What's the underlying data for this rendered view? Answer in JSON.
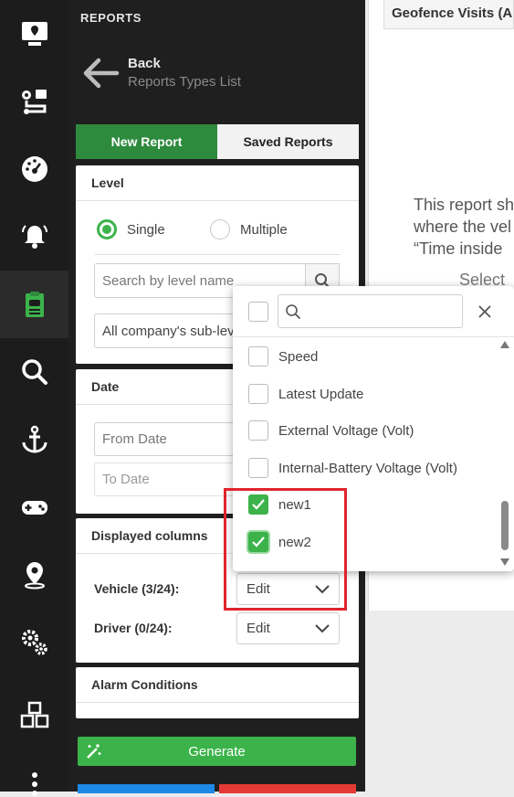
{
  "sidebar": {
    "icons": [
      "monitor-pin-icon",
      "route-icon",
      "dashboard-icon",
      "alarm-bell-icon",
      "reports-clipboard-icon",
      "search-icon",
      "anchor-icon",
      "gamepad-icon",
      "location-pin-icon",
      "gears-icon",
      "cubes-icon",
      "more-vertical-icon"
    ],
    "active_index": 4
  },
  "panel": {
    "title": "REPORTS",
    "back_label": "Back",
    "back_sub": "Reports Types List",
    "tabs": {
      "new": "New Report",
      "saved": "Saved Reports"
    },
    "level": {
      "title": "Level",
      "single": "Single",
      "multiple": "Multiple",
      "search_placeholder": "Search by level name",
      "sublevels_value": "All company's sub-levels"
    },
    "date": {
      "title": "Date",
      "from_placeholder": "From Date",
      "to_placeholder": "To Date"
    },
    "columns": {
      "title": "Displayed columns",
      "vehicle_label": "Vehicle (3/24):",
      "driver_label": "Driver (0/24):",
      "edit_label": "Edit"
    },
    "alarm_title": "Alarm Conditions",
    "generate_label": "Generate"
  },
  "main": {
    "tab_title": "Geofence Visits (Alarm",
    "desc_lines": [
      "This report sh",
      "where the vel",
      "“Time inside",
      "Select"
    ]
  },
  "dropdown": {
    "items": [
      {
        "label": "Speed",
        "checked": false
      },
      {
        "label": "Latest Update",
        "checked": false
      },
      {
        "label": "External Voltage (Volt)",
        "checked": false
      },
      {
        "label": "Internal-Battery Voltage (Volt)",
        "checked": false
      },
      {
        "label": "new1",
        "checked": true
      },
      {
        "label": "new2",
        "checked": true
      }
    ]
  },
  "colors": {
    "accent_green": "#3cb34a",
    "tab_green": "#2e8b3e",
    "highlight_red": "#e0242b",
    "rail_bg": "#1c1c1c",
    "blue_button": "#1e88e5",
    "red_button": "#e53935"
  }
}
